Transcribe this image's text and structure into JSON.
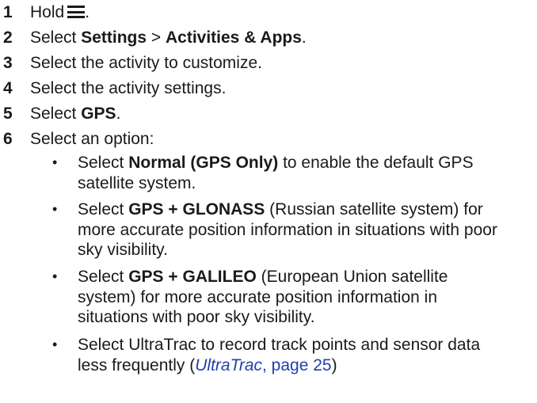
{
  "steps": [
    {
      "num": "1",
      "text": "Hold",
      "after_icon": ".",
      "icon": "menu-icon"
    },
    {
      "num": "2",
      "pre": "Select ",
      "b1": "Settings",
      "mid": " > ",
      "b2": "Activities & Apps",
      "post": "."
    },
    {
      "num": "3",
      "text": "Select the activity to customize."
    },
    {
      "num": "4",
      "text": "Select the activity settings."
    },
    {
      "num": "5",
      "pre": "Select ",
      "bold": "GPS",
      "post": "."
    },
    {
      "num": "6",
      "text": "Select an option:"
    }
  ],
  "bullet_char": "•",
  "options": [
    {
      "pre": "Select ",
      "bold": "Normal (GPS Only)",
      "line1_post": " to enable the default GPS",
      "lines": [
        "satellite system."
      ]
    },
    {
      "pre": "Select ",
      "bold": "GPS + GLONASS",
      "line1_post": " (Russian satellite system) for",
      "lines": [
        "more accurate position information in situations with poor",
        "sky visibility."
      ]
    },
    {
      "pre": "Select ",
      "bold": "GPS + GALILEO",
      "line1_post": " (European Union satellite",
      "lines": [
        "system) for more accurate position information in",
        "situations with poor sky visibility."
      ]
    },
    {
      "line1": "Select UltraTrac to record track points and sensor data",
      "line2_pre": "less frequently (",
      "link_italic": "UltraTrac",
      "link_rest": ", page 25",
      "line2_post": ")"
    }
  ],
  "colors": {
    "text": "#1a1a1a",
    "link": "#1f3fb0"
  }
}
